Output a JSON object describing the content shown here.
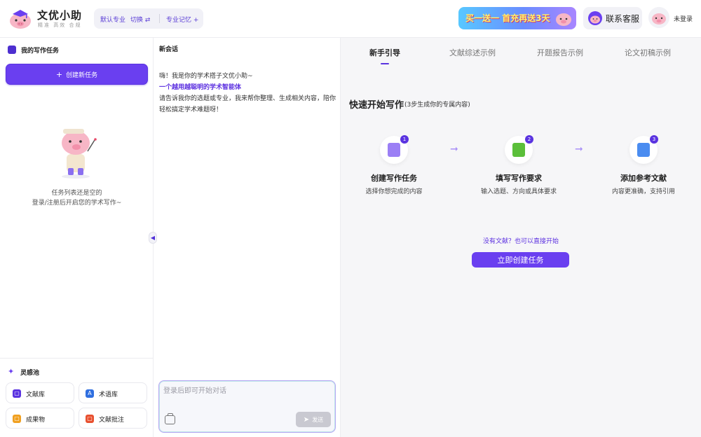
{
  "header": {
    "brand_title": "文优小助",
    "brand_sub": "精准 高效 合规",
    "major_default": "默认专业",
    "major_switch": "切换 ⇄",
    "major_memory": "专业记忆 +",
    "promo_text": "买一送一 首充再送3天",
    "service_label": "联系客服",
    "user_label": "未登录"
  },
  "sidebar": {
    "task_heading": "我的写作任务",
    "create_button": "创建新任务",
    "empty_line1": "任务列表还是空的",
    "empty_line2": "登录/注册后开启您的学术写作~",
    "inspiration_title": "灵感池",
    "tiles": [
      {
        "label": "文献库",
        "color": "#5a33e0",
        "glyph": "▢"
      },
      {
        "label": "术语库",
        "color": "#2f6fe0",
        "glyph": "A"
      },
      {
        "label": "成果物",
        "color": "#f0a020",
        "glyph": "▢"
      },
      {
        "label": "文献批注",
        "color": "#e8502f",
        "glyph": "▢"
      }
    ]
  },
  "chat": {
    "title": "新会话",
    "greeting": "嗨！我是你的学术搭子文优小助~",
    "tagline": "一个越用越聪明的学术智能体",
    "intro": "请告诉我你的选题或专业，我来帮你整理、生成相关内容，陪你轻松搞定学术难题呀！",
    "input_placeholder": "登录后即可开始对话",
    "send_label": "发送"
  },
  "guide": {
    "tabs": [
      "新手引导",
      "文献综述示例",
      "开题报告示例",
      "论文初稿示例"
    ],
    "title": "快速开始写作",
    "subtitle": "(3步生成你的专属内容)",
    "steps": [
      {
        "num": "1",
        "title": "创建写作任务",
        "desc": "选择你想完成的内容",
        "color": "#9b7ff5"
      },
      {
        "num": "2",
        "title": "填写写作要求",
        "desc": "输入选题、方向或具体要求",
        "color": "#5bbf3a"
      },
      {
        "num": "3",
        "title": "添加参考文献",
        "desc": "内容更准确，支持引用",
        "color": "#4a8cf0"
      }
    ],
    "no_literature": "没有文献？也可以直接开始",
    "start_button": "立即创建任务"
  },
  "colors": {
    "accent": "#6a3ff0",
    "accent_dark": "#5a33e0"
  }
}
